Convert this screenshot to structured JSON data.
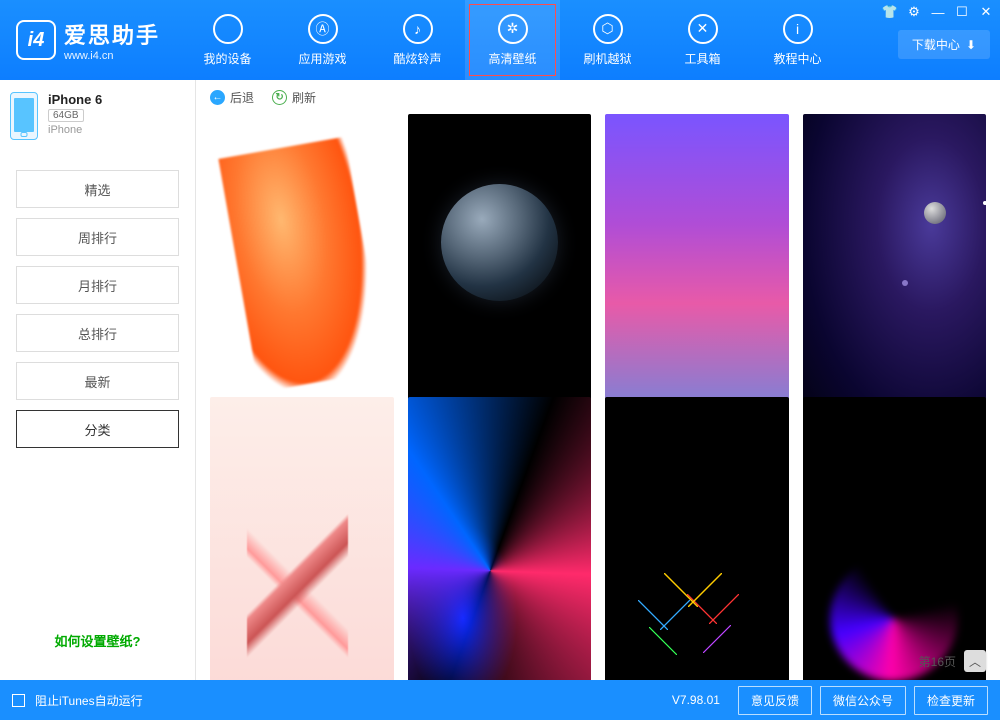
{
  "app": {
    "title": "爱思助手",
    "url": "www.i4.cn"
  },
  "nav": [
    {
      "label": "我的设备",
      "icon": ""
    },
    {
      "label": "应用游戏",
      "icon": "Ⓐ"
    },
    {
      "label": "酷炫铃声",
      "icon": "♪"
    },
    {
      "label": "高清壁纸",
      "icon": "✲",
      "active": true
    },
    {
      "label": "刷机越狱",
      "icon": "⬡"
    },
    {
      "label": "工具箱",
      "icon": "✕"
    },
    {
      "label": "教程中心",
      "icon": "i"
    }
  ],
  "download_center": "下载中心",
  "device": {
    "name": "iPhone 6",
    "capacity": "64GB",
    "type": "iPhone"
  },
  "sidebar": {
    "tabs": [
      {
        "label": "精选"
      },
      {
        "label": "周排行"
      },
      {
        "label": "月排行"
      },
      {
        "label": "总排行"
      },
      {
        "label": "最新"
      },
      {
        "label": "分类",
        "active": true
      }
    ],
    "help": "如何设置壁纸?"
  },
  "toolbar": {
    "back": "后退",
    "refresh": "刷新"
  },
  "wallpapers": [
    "wp1",
    "wp2",
    "wp3",
    "wp4",
    "wp5",
    "wp6",
    "wp7",
    "wp8"
  ],
  "page_indicator": "第16页",
  "statusbar": {
    "block_itunes": "阻止iTunes自动运行",
    "version": "V7.98.01",
    "buttons": [
      "意见反馈",
      "微信公众号",
      "检查更新"
    ]
  }
}
